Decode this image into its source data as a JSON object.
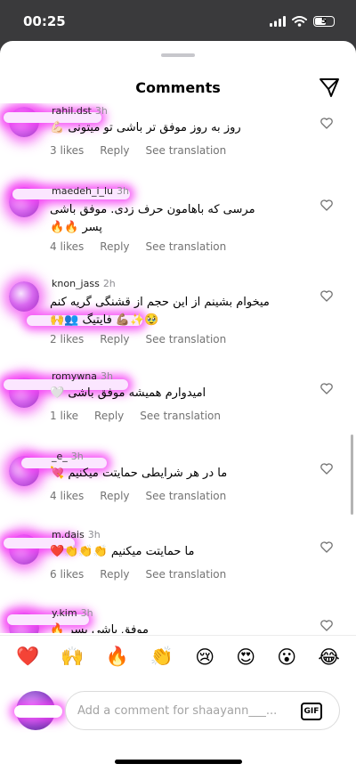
{
  "status": {
    "time": "00:25",
    "battery": "5"
  },
  "header": {
    "title": "Comments"
  },
  "comments": [
    {
      "username": "rahil.dst",
      "time": "3h",
      "text": "روز به روز موفق تر باشی تو میتونی 💪🏻",
      "likes": "3 likes",
      "reply": "Reply",
      "translate": "See translation"
    },
    {
      "username": "maedeh_i_lu",
      "time": "3h",
      "text": "مرسی که باهامون حرف زدی. موفق باشی پسر 🔥🔥",
      "likes": "4 likes",
      "reply": "Reply",
      "translate": "See translation"
    },
    {
      "username": "knon_jass",
      "time": "2h",
      "text": "میخوام بشینم از این حجم از قشنگی گریه کنم 🥹✨💪🏽 فایتیگ 👥🙌",
      "likes": "2 likes",
      "reply": "Reply",
      "translate": "See translation"
    },
    {
      "username": "romywna",
      "time": "3h",
      "text": "امیدوارم همیشه موفق باشی 🤍",
      "likes": "1 like",
      "reply": "Reply",
      "translate": "See translation"
    },
    {
      "username": "_e_",
      "time": "3h",
      "text": "ما در هر شرایطی حمایتت میکنیم 💘",
      "likes": "4 likes",
      "reply": "Reply",
      "translate": "See translation"
    },
    {
      "username": "m.dais",
      "time": "3h",
      "text": "ما حمایتت میکنیم 👏👏👏❤️",
      "likes": "6 likes",
      "reply": "Reply",
      "translate": "See translation"
    },
    {
      "username": "y.kim",
      "time": "3h",
      "text": "موفق باشی پسر 🔥",
      "likes": "",
      "reply": "",
      "translate": ""
    }
  ],
  "emoji_bar": [
    "❤️",
    "🙌",
    "🔥",
    "👏",
    "😢",
    "😍",
    "😮",
    "😂"
  ],
  "input": {
    "placeholder": "Add a comment for shaayann___...",
    "gif_label": "GIF"
  }
}
